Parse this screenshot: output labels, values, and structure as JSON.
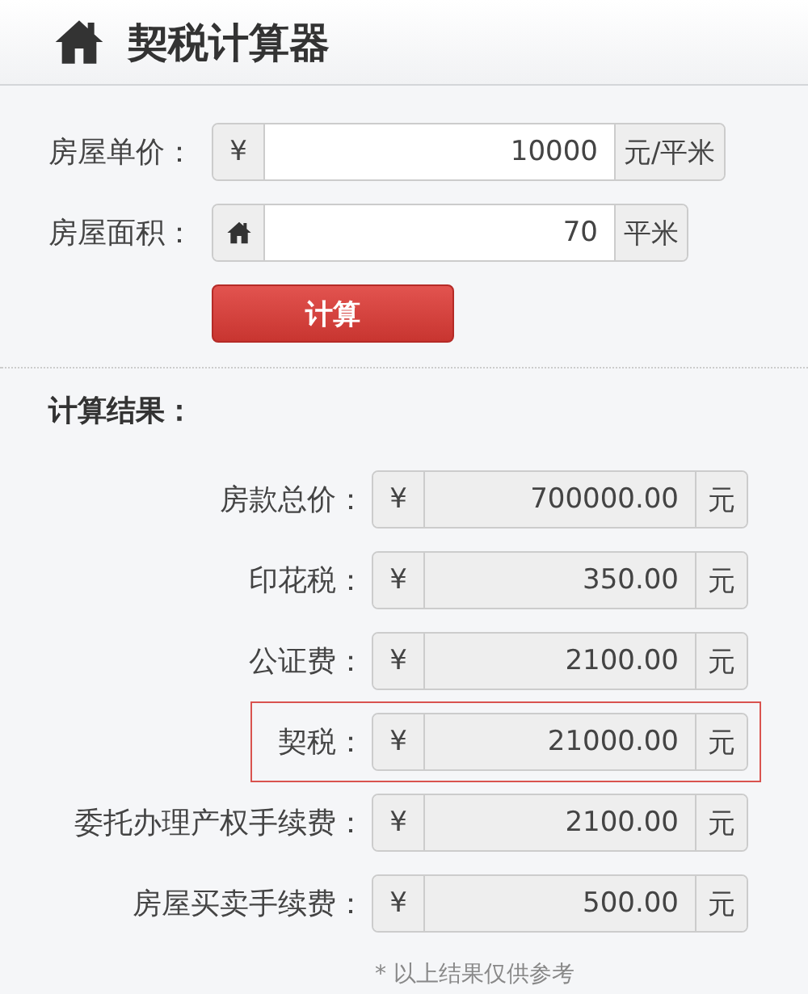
{
  "header": {
    "title": "契税计算器"
  },
  "inputs": [
    {
      "label": "房屋单价：",
      "kind": "text",
      "prefix": "¥",
      "value": "10000",
      "unit": "元/平米"
    },
    {
      "label": "房屋面积：",
      "kind": "home",
      "value": "70",
      "unit": "平米"
    }
  ],
  "button": "计算",
  "results_title": "计算结果：",
  "results": [
    {
      "label": "房款总价：",
      "prefix": "¥",
      "value": "700000.00",
      "unit": "元",
      "highlighted": false
    },
    {
      "label": "印花税：",
      "prefix": "¥",
      "value": "350.00",
      "unit": "元",
      "highlighted": false
    },
    {
      "label": "公证费：",
      "prefix": "¥",
      "value": "2100.00",
      "unit": "元",
      "highlighted": false
    },
    {
      "label": "契税：",
      "prefix": "¥",
      "value": "21000.00",
      "unit": "元",
      "highlighted": true
    },
    {
      "label": "委托办理产权手续费：",
      "prefix": "¥",
      "value": "2100.00",
      "unit": "元",
      "highlighted": false
    },
    {
      "label": "房屋买卖手续费：",
      "prefix": "¥",
      "value": "500.00",
      "unit": "元",
      "highlighted": false
    }
  ],
  "footnote": "* 以上结果仅供参考"
}
